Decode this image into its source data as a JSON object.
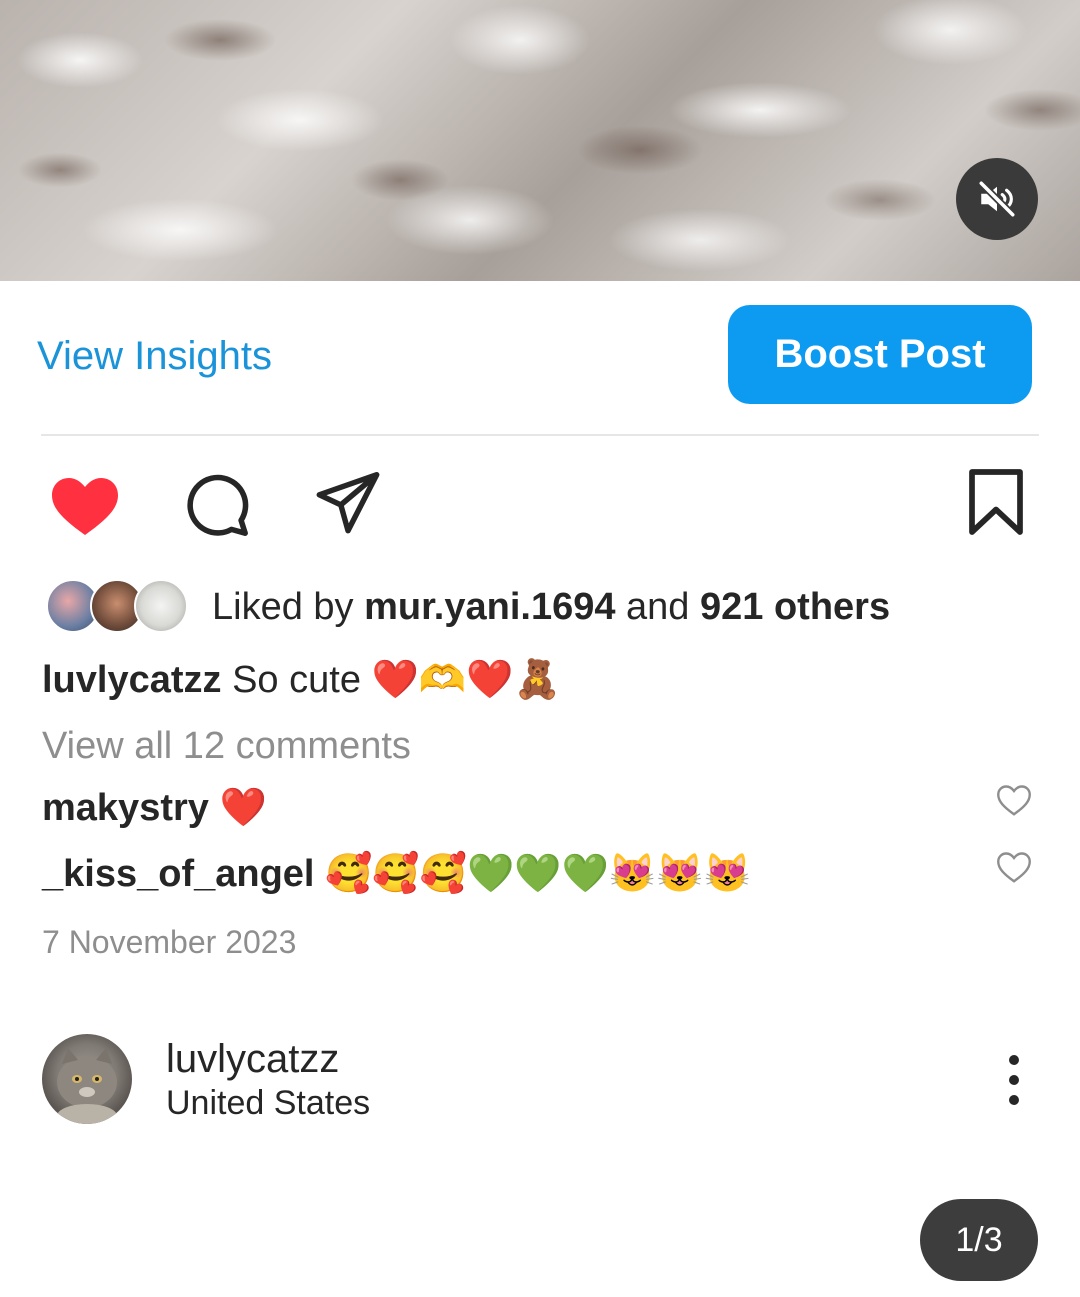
{
  "post": {
    "mute_icon": "speaker-muted-icon",
    "pager": "1/3"
  },
  "owner_actions": {
    "insights_label": "View Insights",
    "boost_label": "Boost Post",
    "boost_color": "#0d9bf2",
    "link_color": "#1a93d9"
  },
  "actions": {
    "like_icon": "heart-filled-icon",
    "like_color": "#ff3040",
    "comment_icon": "comment-icon",
    "share_icon": "send-icon",
    "save_icon": "bookmark-icon"
  },
  "likes": {
    "prefix": "Liked by ",
    "user": "mur.yani.1694",
    "middle": " and ",
    "count": "921 others"
  },
  "caption": {
    "username": "luvlycatzz",
    "text": " So cute ❤️🫶❤️🧸"
  },
  "comments": {
    "view_all": "View all 12 comments",
    "items": [
      {
        "username": "makystry",
        "text": " ❤️"
      },
      {
        "username": "_kiss_of_angel",
        "text": " 🥰🥰🥰💚💚💚😻😻😻"
      }
    ]
  },
  "date": "7 November 2023",
  "author": {
    "username": "luvlycatzz",
    "location": "United States"
  }
}
